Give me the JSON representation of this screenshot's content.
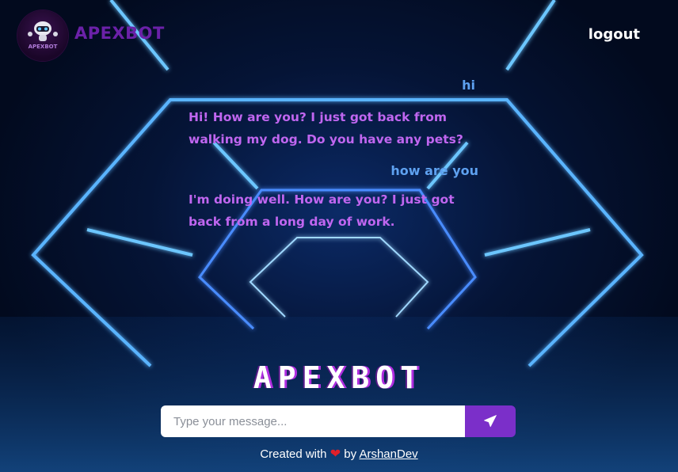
{
  "header": {
    "brand": "APEXBOT",
    "logo_text": "APEXBOT",
    "logout_label": "logout"
  },
  "chat": {
    "messages": [
      {
        "sender": "user",
        "text": "hi"
      },
      {
        "sender": "bot",
        "text": "Hi! How are you? I just got back from walking my dog. Do you have any pets?"
      },
      {
        "sender": "user",
        "text": "how are you"
      },
      {
        "sender": "bot",
        "text": "I'm doing well. How are you? I just got back from a long day of work."
      }
    ]
  },
  "title": "APEXBOT",
  "input": {
    "placeholder": "Type your message...",
    "value": ""
  },
  "send_button": {
    "icon": "paper-plane-icon"
  },
  "footer": {
    "prefix": "Created with",
    "heart": "❤",
    "by": "by",
    "author": "ArshanDev"
  },
  "colors": {
    "brand": "#6b21a8",
    "user_message": "#5ea1f0",
    "bot_message": "#c066f0",
    "send_button": "#7b2fc9",
    "heart": "#e0202a"
  }
}
